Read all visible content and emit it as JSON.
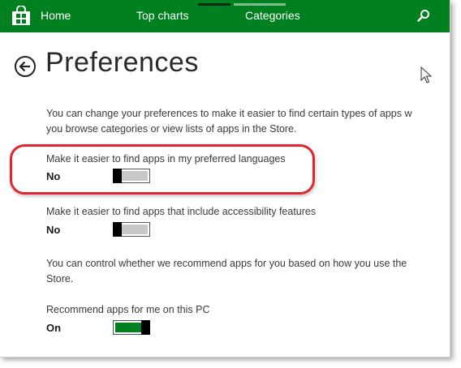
{
  "nav": {
    "items": [
      "Home",
      "Top charts",
      "Categories"
    ],
    "search_icon": "search-icon",
    "store_icon": "store-bag-icon",
    "bar_color": "#00801e"
  },
  "page": {
    "title": "Preferences",
    "back_icon": "back-arrow-icon"
  },
  "settings": {
    "intro": [
      "You can change your preferences to make it easier to find certain types of apps w",
      "you browse categories or view lists of apps in the Store."
    ],
    "languages": {
      "label": "Make it easier to find apps in my preferred languages",
      "value": "No",
      "state": "off"
    },
    "accessibility": {
      "label": "Make it easier to find apps that include accessibility features",
      "value": "No",
      "state": "off"
    },
    "recommend_intro": [
      "You can control whether we recommend apps for you based on how you use the",
      "Store."
    ],
    "recommend": {
      "label": "Recommend apps for me on this PC",
      "value": "On",
      "state": "on"
    }
  },
  "annotation": {
    "highlight_color": "#e0252c"
  }
}
